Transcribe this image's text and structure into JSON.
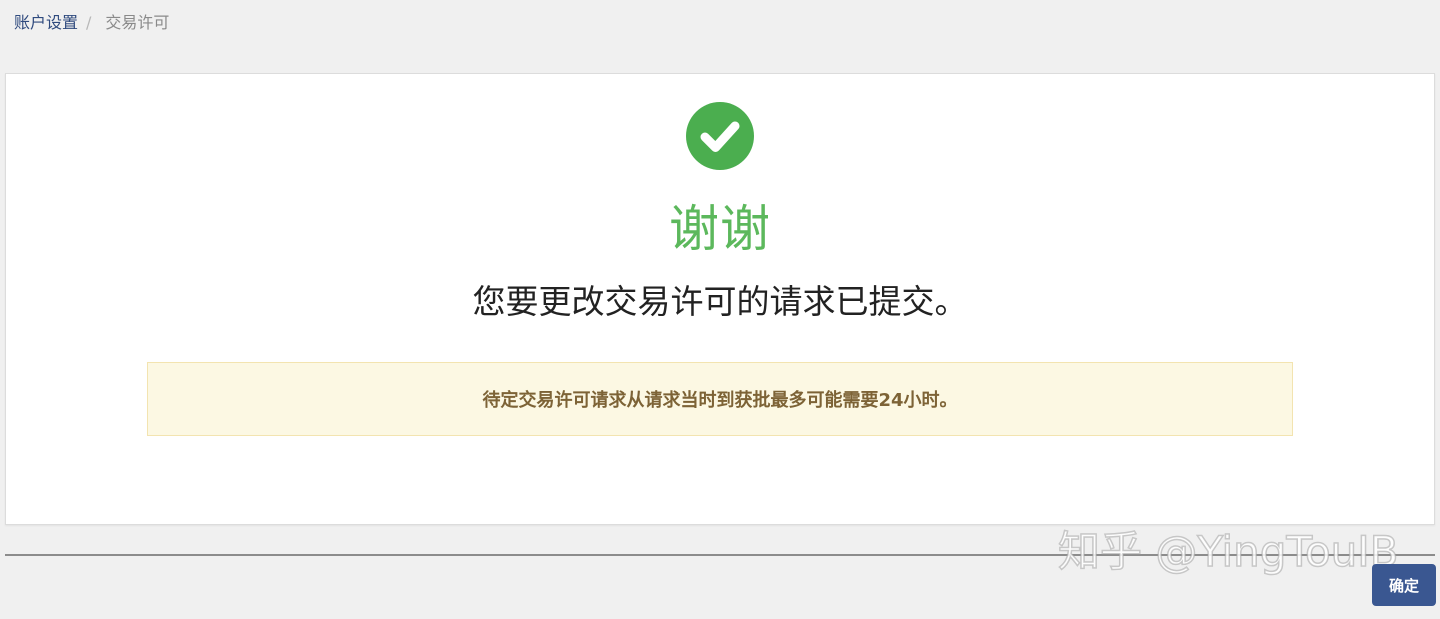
{
  "breadcrumb": {
    "parent": "账户设置",
    "separator": "/",
    "current": "交易许可"
  },
  "success": {
    "icon": "check-circle-icon",
    "icon_color": "#4bae4f",
    "title": "谢谢",
    "title_color": "#5cb85c",
    "message": "您要更改交易许可的请求已提交。"
  },
  "notice": {
    "text": "待定交易许可请求从请求当时到获批最多可能需要24小时。",
    "background": "#fcf8e3",
    "text_color": "#7d6336"
  },
  "footer": {
    "confirm_label": "确定",
    "button_color": "#3a5791"
  },
  "watermark": {
    "text": "知乎 @YingTouIB"
  }
}
